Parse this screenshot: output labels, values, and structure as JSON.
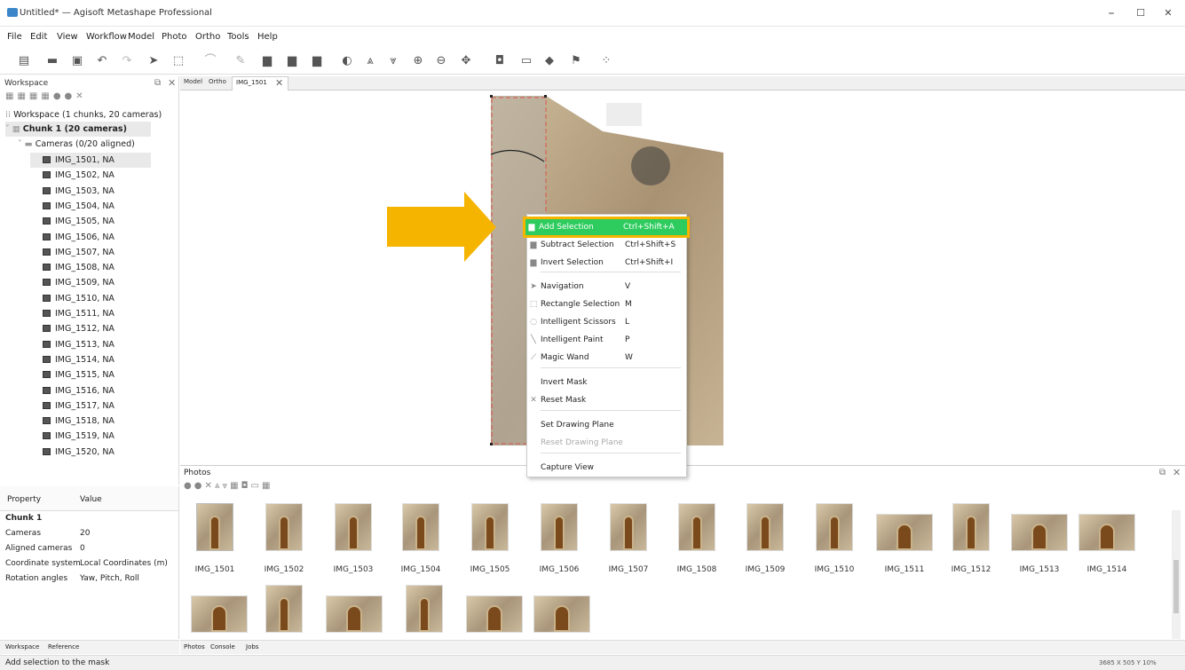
{
  "window": {
    "title": "Untitled* — Agisoft Metashape Professional",
    "min": "–",
    "max": "☐",
    "close": "✕"
  },
  "menu": [
    "File",
    "Edit",
    "View",
    "Workflow",
    "Model",
    "Photo",
    "Ortho",
    "Tools",
    "Help"
  ],
  "workspace": {
    "title": "Workspace",
    "root": "Workspace (1 chunks, 20 cameras)",
    "chunk": "Chunk 1 (20 cameras)",
    "cameras_folder": "Cameras (0/20 aligned)",
    "cameras": [
      "IMG_1501, NA",
      "IMG_1502, NA",
      "IMG_1503, NA",
      "IMG_1504, NA",
      "IMG_1505, NA",
      "IMG_1506, NA",
      "IMG_1507, NA",
      "IMG_1508, NA",
      "IMG_1509, NA",
      "IMG_1510, NA",
      "IMG_1511, NA",
      "IMG_1512, NA",
      "IMG_1513, NA",
      "IMG_1514, NA",
      "IMG_1515, NA",
      "IMG_1516, NA",
      "IMG_1517, NA",
      "IMG_1518, NA",
      "IMG_1519, NA",
      "IMG_1520, NA"
    ]
  },
  "properties": {
    "col_property": "Property",
    "col_value": "Value",
    "group": "Chunk 1",
    "rows": [
      [
        "Cameras",
        "20"
      ],
      [
        "Aligned cameras",
        "0"
      ],
      [
        "Coordinate system",
        "Local Coordinates (m)"
      ],
      [
        "Rotation angles",
        "Yaw, Pitch, Roll"
      ]
    ]
  },
  "left_tabs": [
    "Workspace",
    "Reference"
  ],
  "view_tabs": [
    "Model",
    "Ortho",
    "IMG_1501"
  ],
  "photos": {
    "title": "Photos",
    "thumbs": [
      "IMG_1501",
      "IMG_1502",
      "IMG_1503",
      "IMG_1504",
      "IMG_1505",
      "IMG_1506",
      "IMG_1507",
      "IMG_1508",
      "IMG_1509",
      "IMG_1510",
      "IMG_1511",
      "IMG_1512",
      "IMG_1513",
      "IMG_1514"
    ]
  },
  "bottom_tabs": [
    "Photos",
    "Console",
    "Jobs"
  ],
  "context_menu": [
    {
      "label": "Add Selection",
      "shortcut": "Ctrl+Shift+A",
      "icon": "add-selection-icon",
      "highlighted": true
    },
    {
      "label": "Subtract Selection",
      "shortcut": "Ctrl+Shift+S",
      "icon": "subtract-selection-icon"
    },
    {
      "label": "Invert Selection",
      "shortcut": "Ctrl+Shift+I",
      "icon": "invert-selection-icon"
    },
    {
      "label": "Navigation",
      "shortcut": "V",
      "icon": "cursor-icon"
    },
    {
      "label": "Rectangle Selection",
      "shortcut": "M",
      "icon": "rectangle-selection-icon"
    },
    {
      "label": "Intelligent Scissors",
      "shortcut": "L",
      "icon": "scissors-icon"
    },
    {
      "label": "Intelligent Paint",
      "shortcut": "P",
      "icon": "paint-icon"
    },
    {
      "label": "Magic Wand",
      "shortcut": "W",
      "icon": "magic-wand-icon"
    },
    {
      "label": "Invert Mask",
      "shortcut": ""
    },
    {
      "label": "Reset Mask",
      "shortcut": "",
      "icon": "close-icon"
    },
    {
      "label": "Set Drawing Plane",
      "shortcut": ""
    },
    {
      "label": "Reset Drawing Plane",
      "shortcut": "",
      "disabled": true
    },
    {
      "label": "Capture View",
      "shortcut": ""
    }
  ],
  "status": {
    "left": "Add selection to the mask",
    "right": "3685 X 505 Y 10%"
  },
  "colors": {
    "highlight": "#2ecc5e",
    "arrow": "#f5b400"
  }
}
